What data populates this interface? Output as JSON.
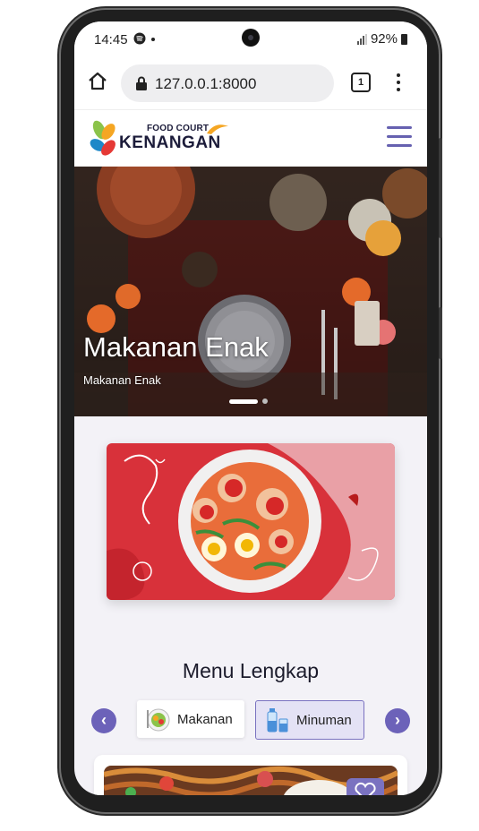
{
  "status_bar": {
    "time": "14:45",
    "battery": "92%"
  },
  "browser": {
    "url": "127.0.0.1:8000",
    "tab_count": "1"
  },
  "site": {
    "logo_top": "FOOD COURT",
    "logo_main": "KENANGAN"
  },
  "hero": {
    "title": "Makanan Enak",
    "subtitle": "Makanan Enak",
    "slide_count": 2,
    "active_slide": 1
  },
  "menu": {
    "title": "Menu Lengkap",
    "prev_arrow": "‹",
    "next_arrow": "›",
    "categories": [
      {
        "label": "Makanan",
        "selected": false
      },
      {
        "label": "Minuman",
        "selected": true
      }
    ]
  },
  "colors": {
    "accent": "#6c62b9",
    "banner_red": "#d8313a",
    "background": "#f3f2f7"
  }
}
